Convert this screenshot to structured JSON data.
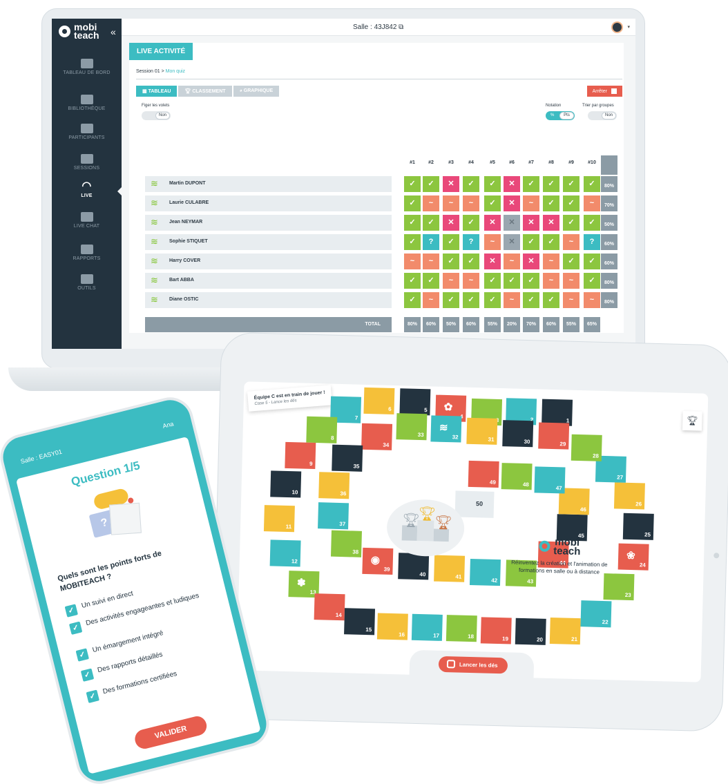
{
  "laptop": {
    "logo_line1": "mobi",
    "logo_line2": "teach",
    "collapse": "«",
    "room_label": "Salle : 43J842",
    "nav": [
      {
        "label": "TABLEAU DE BORD",
        "icon": "dashboard-icon"
      },
      {
        "label": "BIBLIOTHÈQUE",
        "icon": "library-icon"
      },
      {
        "label": "PARTICIPANTS",
        "icon": "participants-icon"
      },
      {
        "label": "SESSIONS",
        "icon": "sessions-icon"
      },
      {
        "label": "LIVE",
        "icon": "wifi-icon",
        "active": true
      },
      {
        "label": "LIVE CHAT",
        "icon": "chat-icon"
      },
      {
        "label": "RAPPORTS",
        "icon": "reports-icon"
      },
      {
        "label": "OUTILS",
        "icon": "tools-icon"
      }
    ],
    "panel_title": "LIVE ACTIVITÉ",
    "breadcrumb_root": "Session 01 >",
    "breadcrumb_link": "Mon quiz",
    "views": [
      "TABLEAU",
      "CLASSEMENT",
      "GRAPHIQUE"
    ],
    "stop_label": "Arrêter",
    "freeze_label": "Figer les volets",
    "freeze_value": "Non",
    "notation_label": "Notation",
    "notation_on": "%",
    "notation_off": "Pts",
    "group_label": "Trier par groupes",
    "group_value": "Non",
    "columns": [
      "#1",
      "#2",
      "#3",
      "#4",
      "#5",
      "#6",
      "#7",
      "#8",
      "#9",
      "#10"
    ],
    "rows": [
      {
        "name": "Martin DUPONT",
        "cells": "vvxvvxvvvv",
        "pct": "80%"
      },
      {
        "name": "Laurie CULABRE",
        "cells": "v~~~vx~vv~",
        "pct": "70%"
      },
      {
        "name": "Jean NEYMAR",
        "cells": "vvxvxoxxvv",
        "pct": "50%"
      },
      {
        "name": "Sophie STIQUET",
        "cells": "v?v?~ovv~?",
        "pct": "60%"
      },
      {
        "name": "Harry COVER",
        "cells": "~~vvx~x~vv",
        "pct": "60%"
      },
      {
        "name": "Bart ABBA",
        "cells": "vv~~vvv~~v",
        "pct": "80%"
      },
      {
        "name": "Diane OSTIC",
        "cells": "v~vvv~vv~~",
        "pct": "80%"
      }
    ],
    "total_label": "TOTAL",
    "totals": [
      "80%",
      "60%",
      "50%",
      "60%",
      "55%",
      "20%",
      "70%",
      "60%",
      "55%",
      "65%"
    ],
    "colors": {
      "correct": "#8cc63f",
      "wrong": "#e9487a",
      "partial": "#f28b6b",
      "unknown": "#3cbcc2",
      "none": "#9aa7b0",
      "accent": "#3cbcc2"
    }
  },
  "tablet": {
    "team_line": "Équipe C est en train de jouer !",
    "case_line": "Case 5 - Lance les dés",
    "tiles": [
      "1",
      "2",
      "3",
      "4",
      "5",
      "6",
      "7",
      "8",
      "9",
      "10",
      "11",
      "12",
      "13",
      "14",
      "15",
      "16",
      "17",
      "18",
      "19",
      "20",
      "21",
      "22",
      "23",
      "24",
      "25",
      "26",
      "27",
      "28",
      "29",
      "30",
      "31",
      "32",
      "33",
      "34",
      "35",
      "36",
      "37",
      "38",
      "39",
      "40",
      "41",
      "42",
      "43",
      "44",
      "45",
      "46",
      "47",
      "48",
      "49",
      "50"
    ],
    "finish_number": "50",
    "brand_line1": "mobi",
    "brand_line2": "teach",
    "tagline": "Réinventez la création et l'animation de formations en salle ou à distance",
    "roll_button": "Lancer les dés"
  },
  "phone": {
    "room": "Salle : EASY01",
    "user": "Ana",
    "question_title": "Question 1/5",
    "question": "Quels sont les points forts de MOBITEACH ?",
    "options": [
      "Un suivi en direct",
      "Des activités engageantes et ludiques",
      "Un émargement intégré",
      "Des rapports détaillés",
      "Des formations certifiées"
    ],
    "submit": "VALIDER"
  }
}
